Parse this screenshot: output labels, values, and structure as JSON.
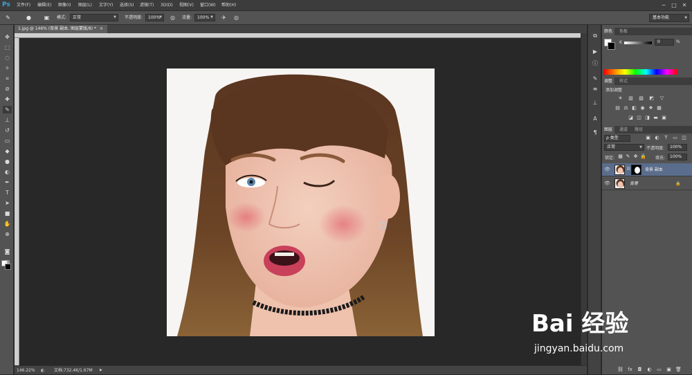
{
  "menubar": {
    "logo": "Ps",
    "items": [
      "文件(F)",
      "编辑(E)",
      "图像(I)",
      "图层(L)",
      "文字(Y)",
      "选择(S)",
      "滤镜(T)",
      "3D(D)",
      "视图(V)",
      "窗口(W)",
      "帮助(H)"
    ],
    "window_buttons": [
      "─",
      "□",
      "✕"
    ]
  },
  "options": {
    "mode_label": "模式:",
    "mode_value": "正常",
    "opacity_label": "不透明度:",
    "opacity_value": "100%",
    "flow_label": "流量:",
    "flow_value": "100%",
    "workspace": "基本功能"
  },
  "document": {
    "tab_title": "1.jpg @ 146% (背景 副本, 图层蒙版/8) *",
    "tab_close": "×",
    "zoom": "146.22%",
    "info": "文档:732.4K/1.67M"
  },
  "color_panel": {
    "tabs": [
      "颜色",
      "色板"
    ],
    "slider_label": "K",
    "value": "0",
    "unit": "%"
  },
  "adjust_panel": {
    "tabs": [
      "调整",
      "样式"
    ],
    "title": "添加调整"
  },
  "layers_panel": {
    "tabs": [
      "图层",
      "通道",
      "路径"
    ],
    "filter": "ρ 类型",
    "blend_mode": "正常",
    "opacity_label": "不透明度:",
    "opacity_value": "100%",
    "lock_label": "锁定:",
    "fill_label": "填充:",
    "fill_value": "100%",
    "layers": [
      {
        "name": "背景 副本",
        "selected": true
      },
      {
        "name": "背景",
        "selected": false
      }
    ]
  },
  "watermark": {
    "logo": "Bai 经验",
    "url": "jingyan.baidu.com"
  },
  "colors": {
    "accent": "#39a6e0",
    "selected_layer": "#5a6d8c"
  }
}
